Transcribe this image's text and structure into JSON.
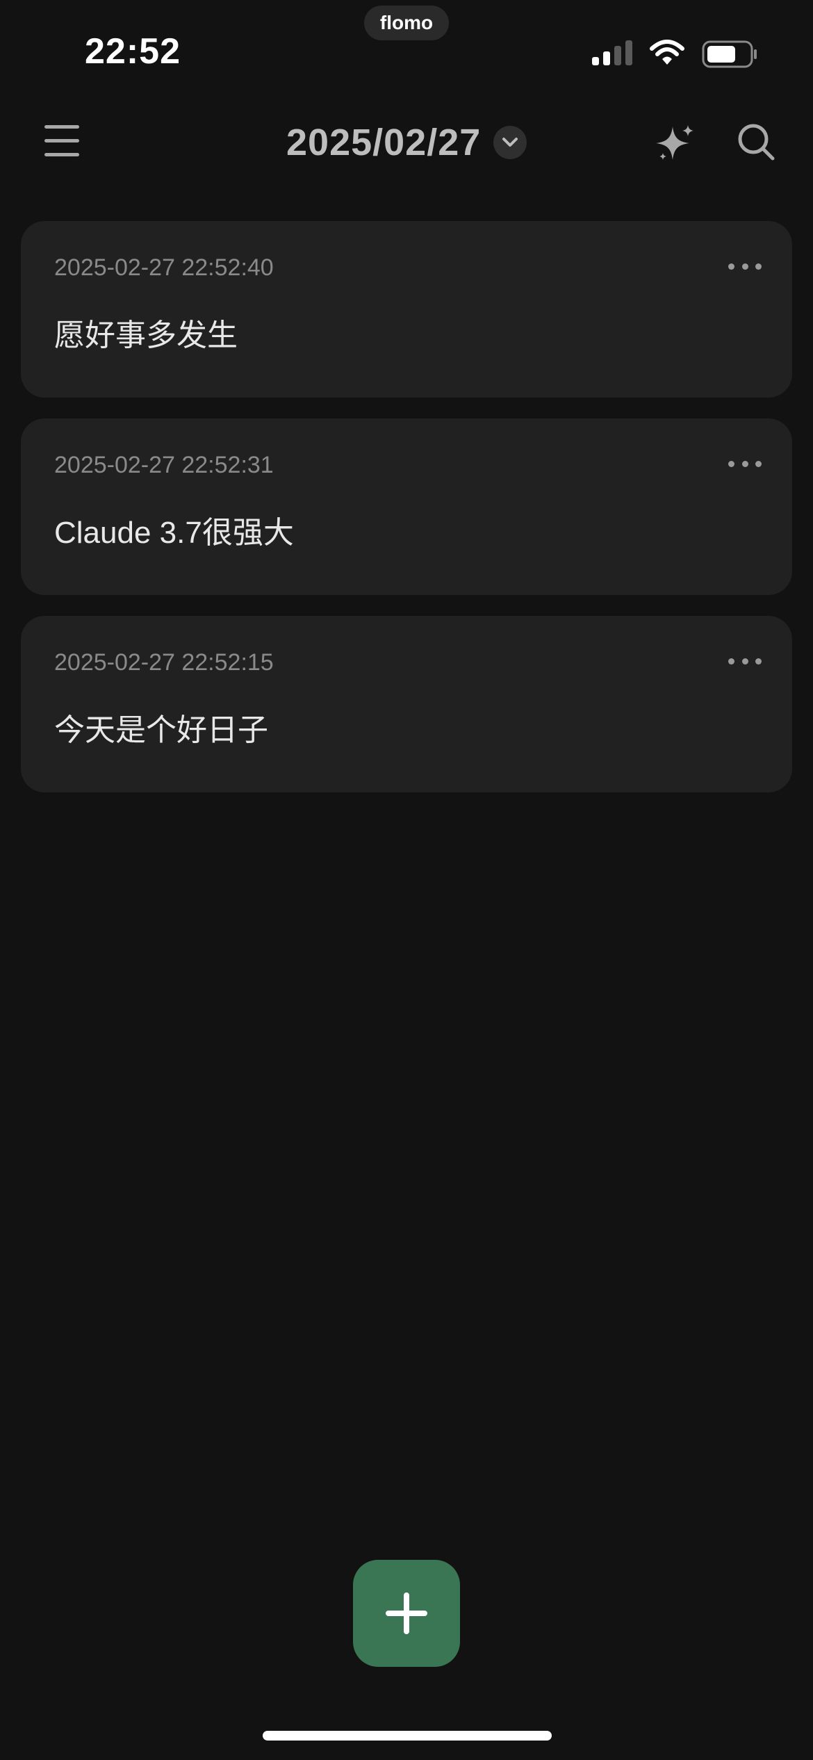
{
  "status_bar": {
    "time": "22:52",
    "app_pill": "flomo",
    "signal_icon": "cellular-signal-icon",
    "wifi_icon": "wifi-icon",
    "battery_icon": "battery-icon"
  },
  "header": {
    "menu_icon": "hamburger-menu-icon",
    "date": "2025/02/27",
    "chevron_icon": "chevron-down-icon",
    "sparkle_icon": "sparkle-icon",
    "search_icon": "search-icon"
  },
  "memos": [
    {
      "timestamp": "2025-02-27 22:52:40",
      "content": "愿好事多发生"
    },
    {
      "timestamp": "2025-02-27 22:52:31",
      "content": "Claude 3.7很强大"
    },
    {
      "timestamp": "2025-02-27 22:52:15",
      "content": "今天是个好日子"
    }
  ],
  "fab": {
    "icon": "plus-icon"
  },
  "colors": {
    "background": "#121212",
    "card": "#212121",
    "accent": "#3a7653",
    "timestamp": "#8a8a8a"
  }
}
